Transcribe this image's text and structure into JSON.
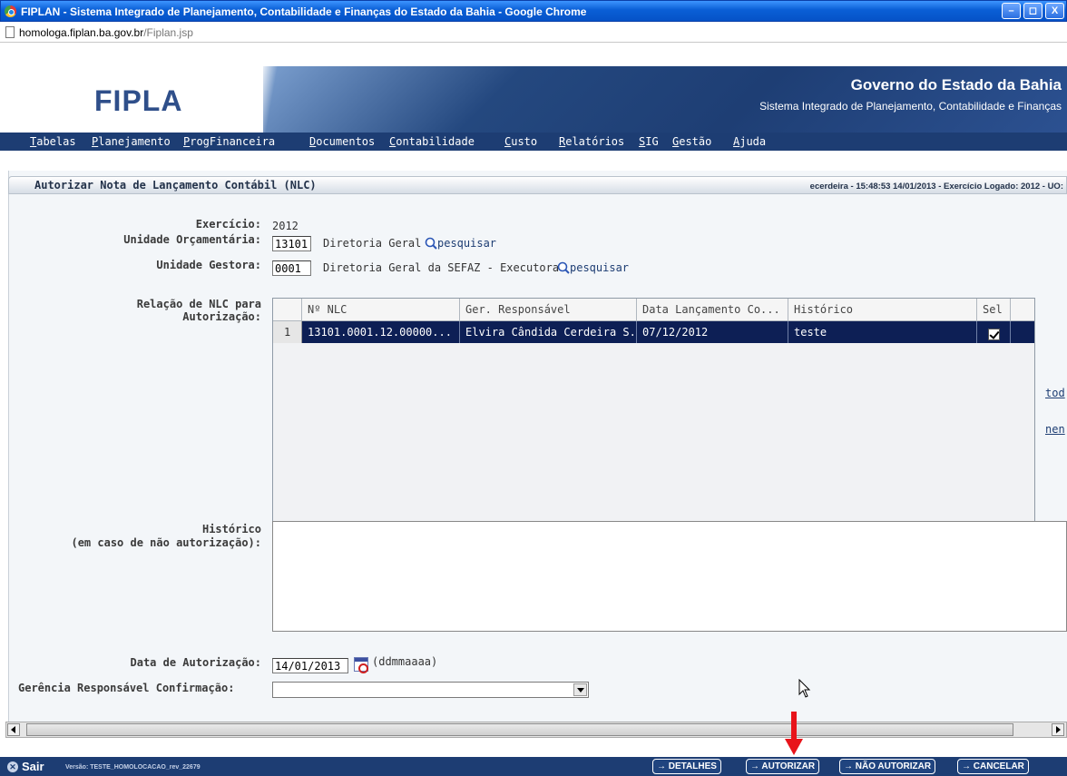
{
  "window": {
    "title": "FIPLAN - Sistema Integrado de Planejamento, Contabilidade e Finanças do Estado da Bahia - Google Chrome",
    "minimize": "–",
    "maximize": "◻",
    "close": "X"
  },
  "addressbar": {
    "host": "homologa.fiplan.ba.gov.br",
    "path": "/Fiplan.jsp"
  },
  "header": {
    "logo": "FIPLAN",
    "gov_title": "Governo do Estado da Bahia",
    "gov_subtitle": "Sistema Integrado de Planejamento, Contabilidade e Finanças"
  },
  "menu": [
    "Tabelas",
    "Planejamento",
    "ProgFinanceira",
    "Documentos",
    "Contabilidade",
    "Custo",
    "Relatórios",
    "SIG",
    "Gestão",
    "Ajuda"
  ],
  "panel": {
    "title": "Autorizar Nota de Lançamento Contábil (NLC)",
    "info": "ecerdeira - 15:48:53 14/01/2013 - Exercício Logado: 2012 - UO:"
  },
  "form": {
    "exercicio_label": "Exercício:",
    "exercicio_value": "2012",
    "uo_label": "Unidade Orçamentária:",
    "uo_code": "13101",
    "uo_name": "Diretoria Geral",
    "ug_label": "Unidade Gestora:",
    "ug_code": "0001",
    "ug_name": "Diretoria Geral da SEFAZ - Executora",
    "pesquisar": "pesquisar",
    "relacao_label_1": "Relação de NLC para",
    "relacao_label_2": "Autorização:",
    "historico_label_1": "Histórico",
    "historico_label_2": "(em caso de não autorização):",
    "data_label": "Data de Autorização:",
    "data_value": "14/01/2013",
    "data_hint": "(ddmmaaaa)",
    "gerencia_label": "Gerência Responsável Confirmação:",
    "gerencia_value": ""
  },
  "grid": {
    "columns": [
      "Nº NLC",
      "Ger. Responsável",
      "Data Lançamento Co...",
      "Histórico",
      "Sel"
    ],
    "rows": [
      {
        "index": "1",
        "nlc": "13101.0001.12.00000...",
        "gerente": "Elvira Cândida Cerdeira S...",
        "data": "07/12/2012",
        "historico": "teste",
        "selected": true
      }
    ]
  },
  "side_links": {
    "todos": "tod",
    "nenhum": "nen"
  },
  "footer": {
    "sair": "Sair",
    "versao": "Versão: TESTE_HOMOLOCACAO_rev_22679",
    "buttons": [
      "→ DETALHES",
      "→ AUTORIZAR",
      "→ NÃO AUTORIZAR",
      "→ CANCELAR"
    ]
  },
  "colors": {
    "navy": "#1d3d73",
    "row_selected": "#0d1f55",
    "annotation_arrow": "#e8141a"
  }
}
